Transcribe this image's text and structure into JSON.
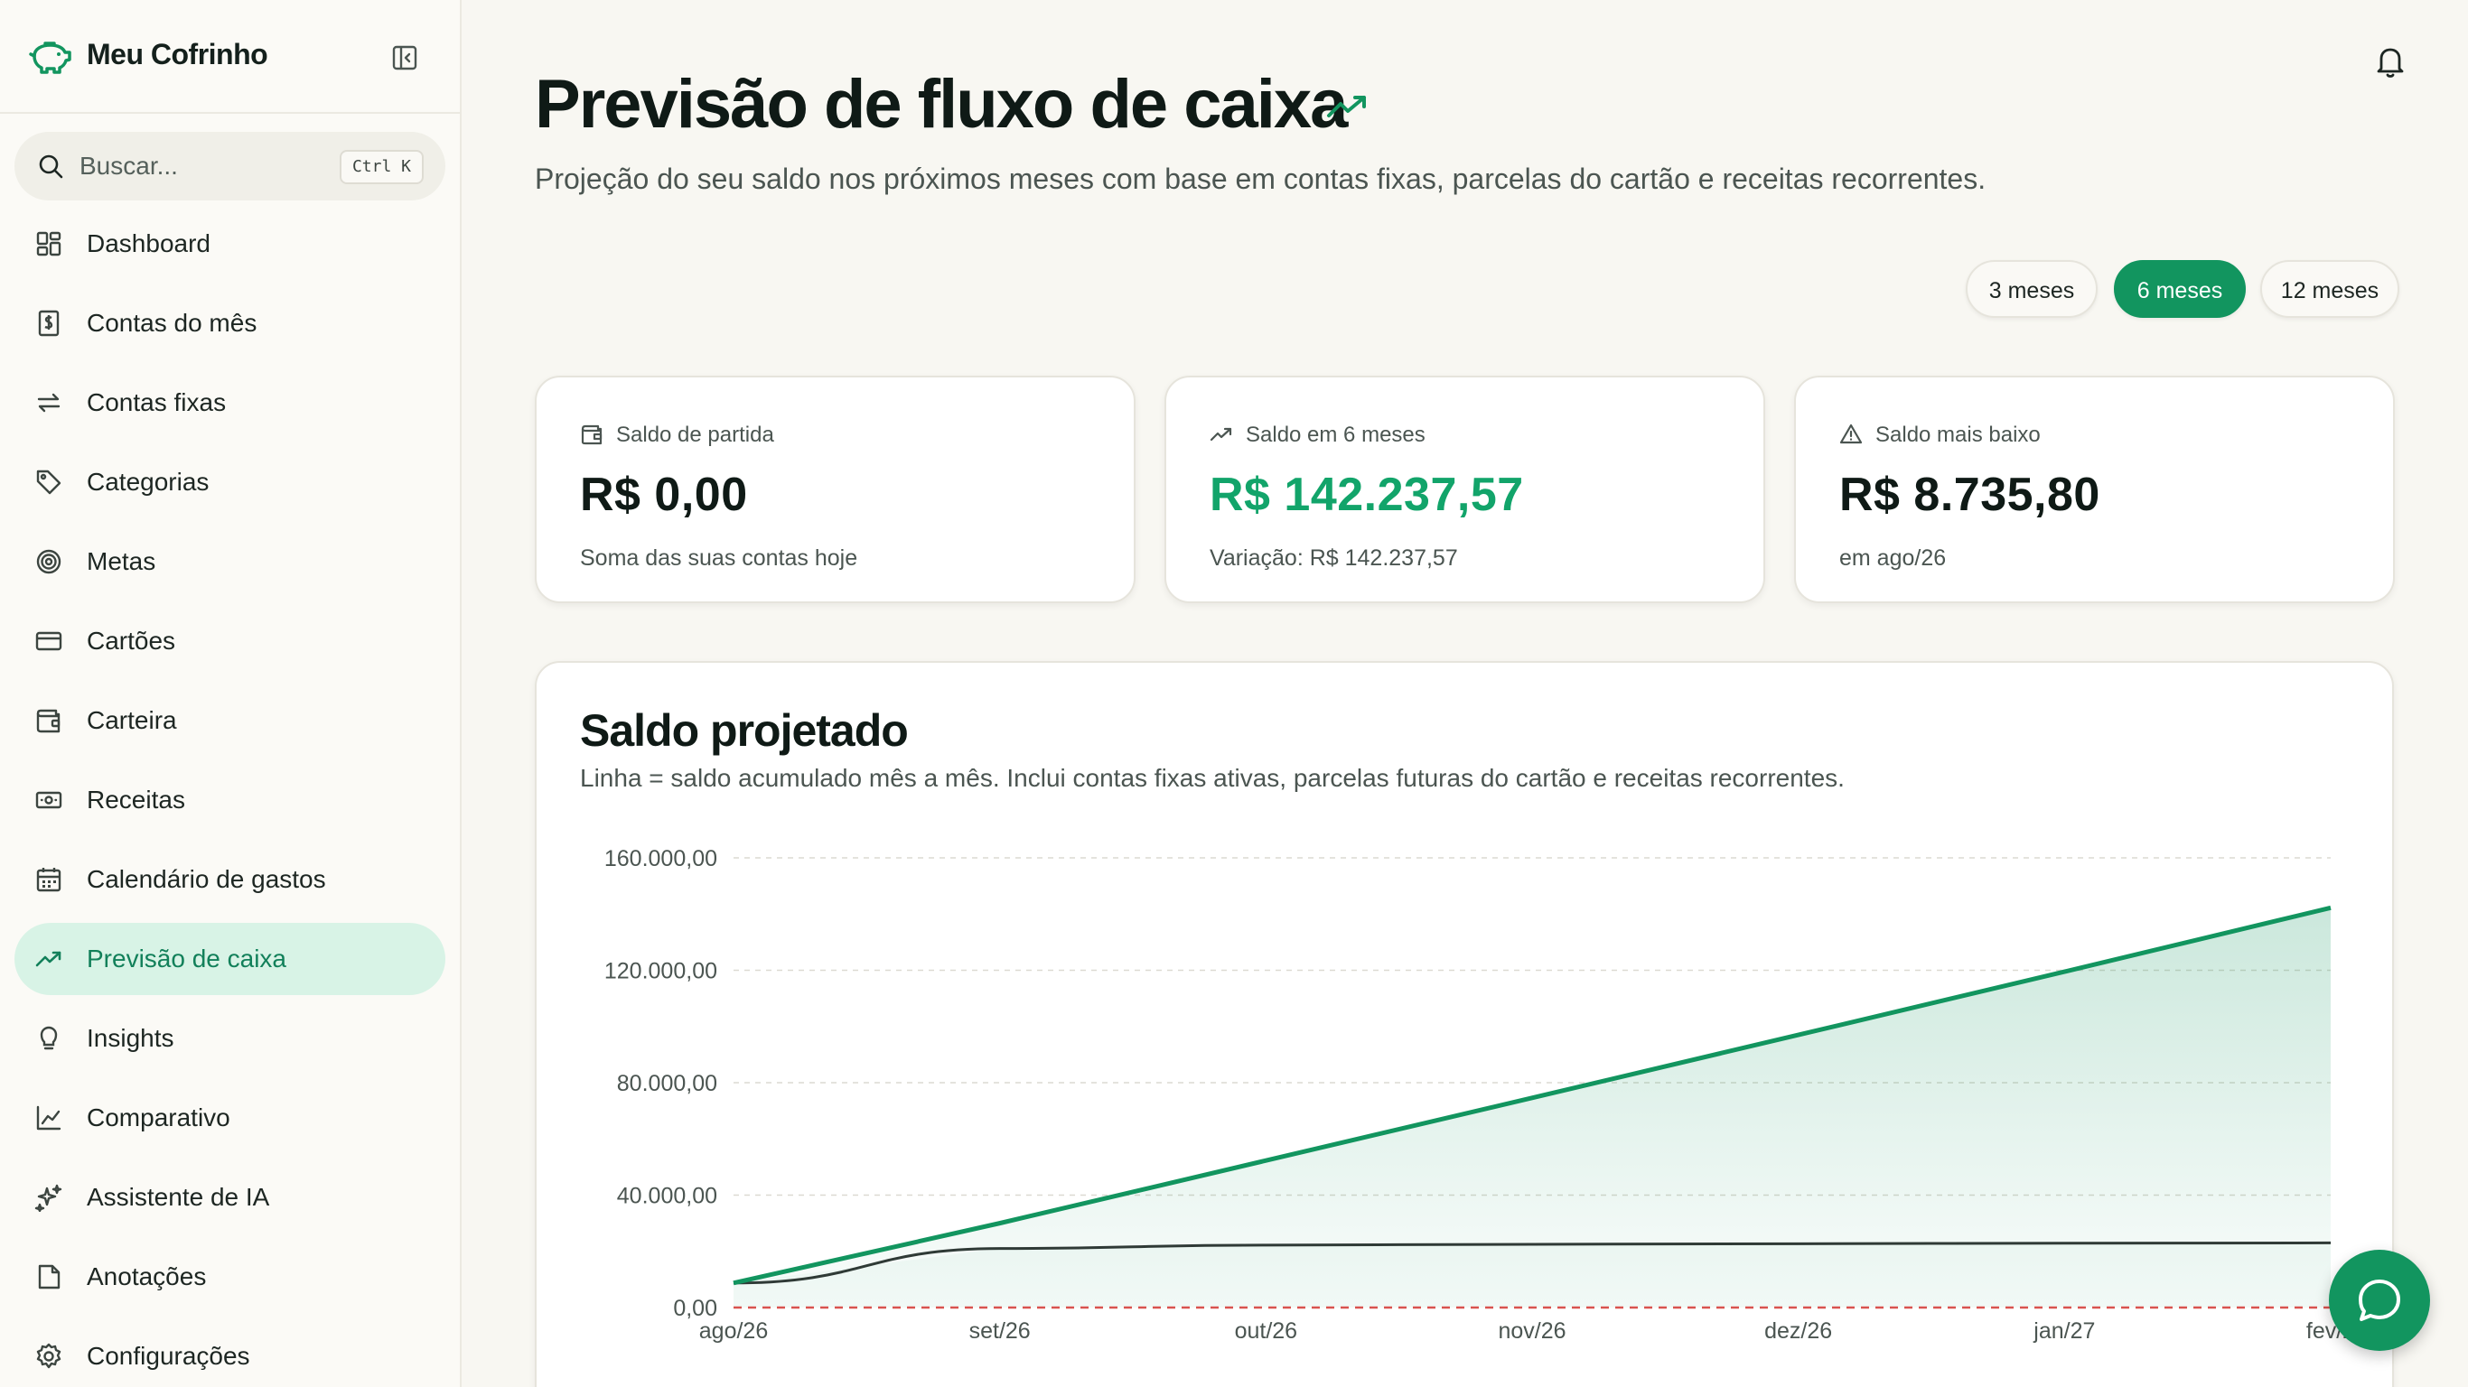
{
  "app": {
    "name": "Meu Cofrinho"
  },
  "search": {
    "placeholder": "Buscar...",
    "shortcut": "Ctrl K"
  },
  "sidebar": {
    "items": [
      {
        "label": "Dashboard",
        "icon": "dashboard-icon",
        "active": false
      },
      {
        "label": "Contas do mês",
        "icon": "receipt-icon",
        "active": false
      },
      {
        "label": "Contas fixas",
        "icon": "repeat-icon",
        "active": false
      },
      {
        "label": "Categorias",
        "icon": "tag-icon",
        "active": false
      },
      {
        "label": "Metas",
        "icon": "target-icon",
        "active": false
      },
      {
        "label": "Cartões",
        "icon": "credit-card-icon",
        "active": false
      },
      {
        "label": "Carteira",
        "icon": "wallet-icon",
        "active": false
      },
      {
        "label": "Receitas",
        "icon": "banknote-icon",
        "active": false
      },
      {
        "label": "Calendário de gastos",
        "icon": "calendar-icon",
        "active": false
      },
      {
        "label": "Previsão de caixa",
        "icon": "trending-up-icon",
        "active": true
      },
      {
        "label": "Insights",
        "icon": "lightbulb-icon",
        "active": false
      },
      {
        "label": "Comparativo",
        "icon": "line-chart-icon",
        "active": false
      },
      {
        "label": "Assistente de IA",
        "icon": "sparkles-icon",
        "active": false
      },
      {
        "label": "Anotações",
        "icon": "note-icon",
        "active": false
      },
      {
        "label": "Configurações",
        "icon": "gear-icon",
        "active": false
      }
    ]
  },
  "header": {
    "title": "Previsão de fluxo de caixa",
    "subtitle": "Projeção do seu saldo nos próximos meses com base em contas fixas, parcelas do cartão e receitas recorrentes."
  },
  "periods": {
    "options": [
      "3 meses",
      "6 meses",
      "12 meses"
    ],
    "selected": "6 meses"
  },
  "cards": [
    {
      "label": "Saldo de partida",
      "value": "R$ 0,00",
      "sub": "Soma das suas contas hoje",
      "icon": "wallet-icon"
    },
    {
      "label": "Saldo em 6 meses",
      "value": "R$ 142.237,57",
      "sub": "Variação: R$ 142.237,57",
      "icon": "trending-up-icon"
    },
    {
      "label": "Saldo mais baixo",
      "value": "R$ 8.735,80",
      "sub": "em ago/26",
      "icon": "alert-triangle-icon"
    }
  ],
  "colors": {
    "accent": "#12955f",
    "accent_light": "#d8f3e6",
    "line_secondary": "#2f3a36",
    "zero_line": "#d9534f"
  },
  "chart_data": {
    "type": "area",
    "title": "Saldo projetado",
    "subtitle": "Linha = saldo acumulado mês a mês. Inclui contas fixas ativas, parcelas futuras do cartão e receitas recorrentes.",
    "x": [
      "ago/26",
      "set/26",
      "out/26",
      "nov/26",
      "dez/26",
      "jan/27",
      "fev/27"
    ],
    "x_tick_labels": [
      "ago/26",
      "set/26",
      "out/26",
      "nov/26",
      "dez/26",
      "jan/27",
      "fev/2"
    ],
    "y_tick_labels": [
      "0,00",
      "40.000,00",
      "80.000,00",
      "120.000,00",
      "160.000,00"
    ],
    "ylim": [
      0,
      160000
    ],
    "series": [
      {
        "values": [
          8735.8,
          30000,
          52300,
          74600,
          97000,
          119500,
          142237.57
        ]
      },
      {
        "values": [
          8735.8,
          21000,
          22200,
          22500,
          22700,
          22900,
          23000
        ]
      }
    ],
    "reference_line": {
      "value": 0,
      "style": "dashed"
    },
    "grid": true
  }
}
